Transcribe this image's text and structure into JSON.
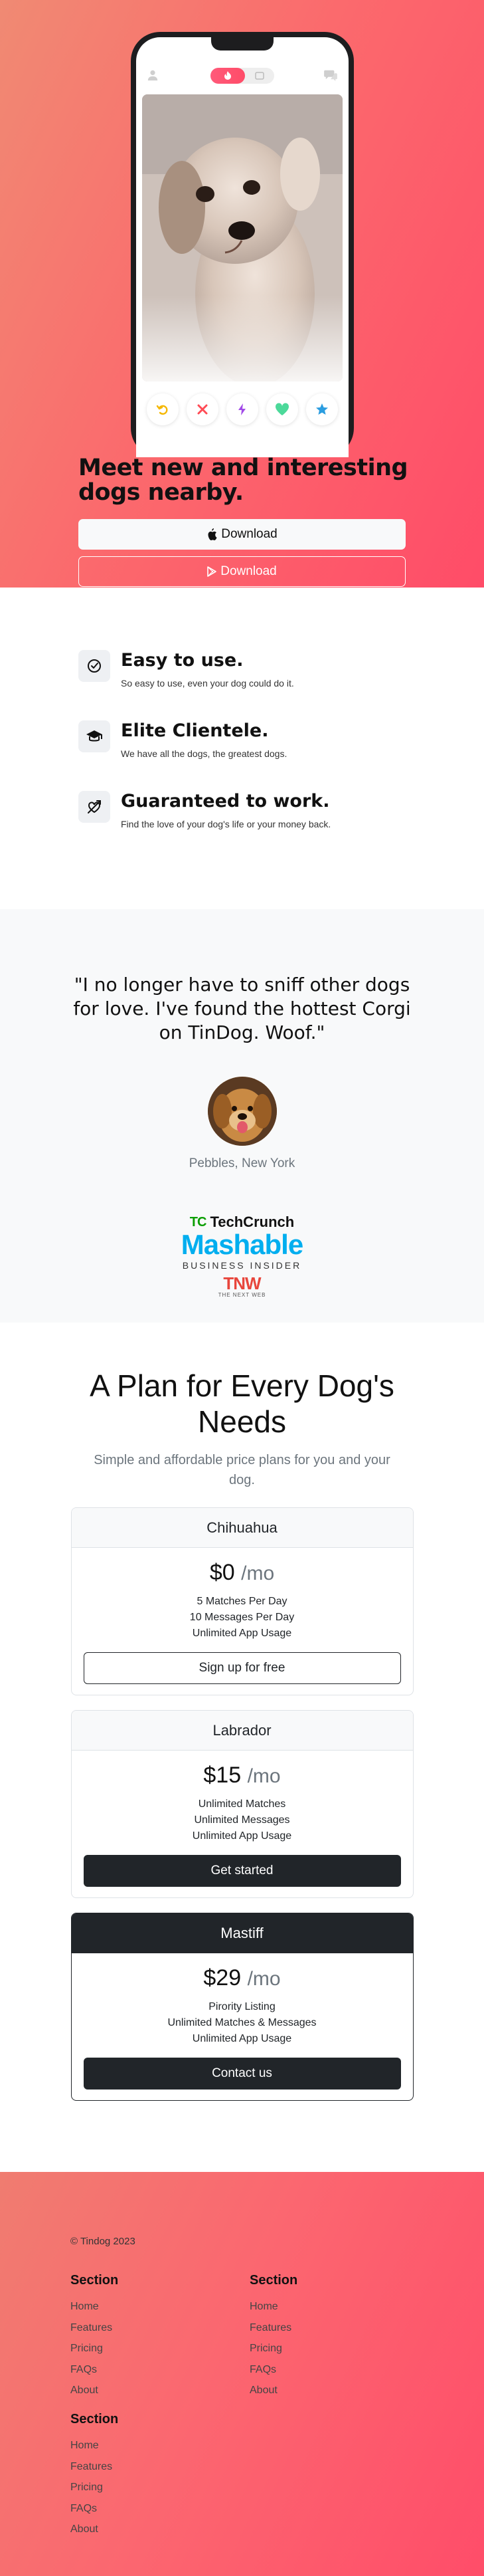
{
  "hero": {
    "title": "Meet new and interesting dogs nearby.",
    "apple_label": "Download",
    "google_label": "Download",
    "apple_icon": "apple-logo-icon",
    "google_icon": "google-play-icon"
  },
  "phone": {
    "actions": [
      "undo-icon",
      "close-icon",
      "bolt-icon",
      "heart-icon",
      "star-icon"
    ]
  },
  "features": [
    {
      "title": "Easy to use.",
      "text": "So easy to use, even your dog could do it.",
      "icon": "check-circle-icon"
    },
    {
      "title": "Elite Clientele.",
      "text": "We have all the dogs, the greatest dogs.",
      "icon": "graduation-cap-icon"
    },
    {
      "title": "Guaranteed to work.",
      "text": "Find the love of your dog's life or your money back.",
      "icon": "heart-arrow-icon"
    }
  ],
  "testimonial": {
    "quote": "\"I no longer have to sniff other dogs for love. I've found the hottest Corgi on TinDog. Woof.\"",
    "cite": "Pebbles, New York"
  },
  "press": {
    "techcrunch": "TechCrunch",
    "techcrunch_mark": "TC",
    "mashable": "Mashable",
    "business_insider": "BUSINESS INSIDER",
    "tnw": "TNW",
    "tnw_sub": "THE NEXT WEB"
  },
  "pricing": {
    "title": "A Plan for Every Dog's Needs",
    "subtitle": "Simple and affordable price plans for you and your dog.",
    "plans": [
      {
        "name": "Chihuahua",
        "price": "$0",
        "unit": "/mo",
        "features": [
          "5 Matches Per Day",
          "10 Messages Per Day",
          "Unlimited App Usage"
        ],
        "button": "Sign up for free"
      },
      {
        "name": "Labrador",
        "price": "$15",
        "unit": "/mo",
        "features": [
          "Unlimited Matches",
          "Unlimited Messages",
          "Unlimited App Usage"
        ],
        "button": "Get started"
      },
      {
        "name": "Mastiff",
        "price": "$29",
        "unit": "/mo",
        "features": [
          "Pirority Listing",
          "Unlimited Matches & Messages",
          "Unlimited App Usage"
        ],
        "button": "Contact us"
      }
    ]
  },
  "footer": {
    "copyright": "© Tindog 2023",
    "sections": [
      {
        "title": "Section",
        "links": [
          "Home",
          "Features",
          "Pricing",
          "FAQs",
          "About"
        ]
      },
      {
        "title": "Section",
        "links": [
          "Home",
          "Features",
          "Pricing",
          "FAQs",
          "About"
        ]
      },
      {
        "title": "Section",
        "links": [
          "Home",
          "Features",
          "Pricing",
          "FAQs",
          "About"
        ]
      }
    ]
  },
  "colors": {
    "brand_gradient_start": "#f08a73",
    "brand_gradient_end": "#ff4c68",
    "dark": "#212529",
    "muted": "#6c757d"
  }
}
